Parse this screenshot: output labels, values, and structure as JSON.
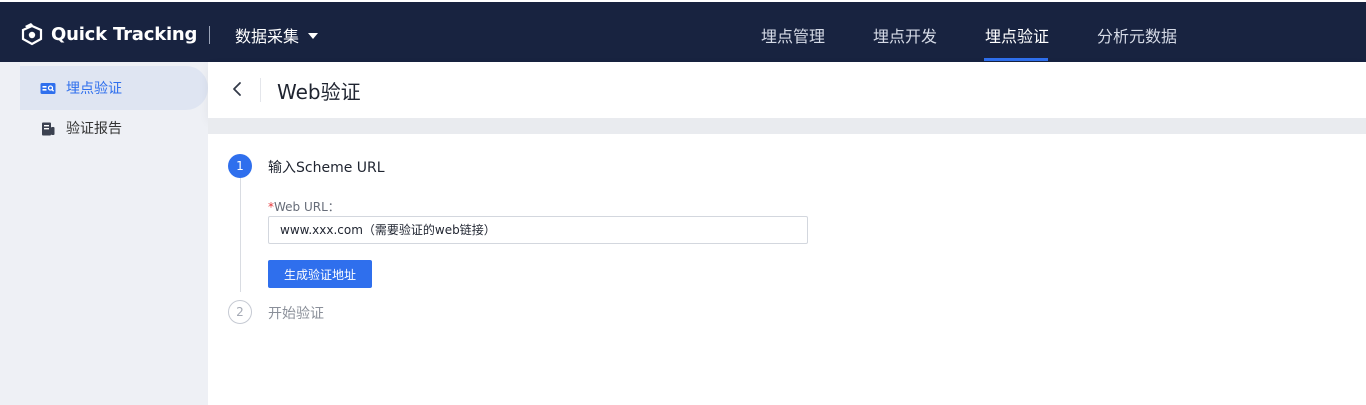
{
  "app": {
    "name": "Quick Tracking",
    "module": "数据采集"
  },
  "nav": {
    "items": [
      {
        "label": "埋点管理"
      },
      {
        "label": "埋点开发"
      },
      {
        "label": "埋点验证"
      },
      {
        "label": "分析元数据"
      }
    ],
    "active_index": 2
  },
  "sidebar": {
    "items": [
      {
        "label": "埋点验证",
        "icon": "id-card-icon"
      },
      {
        "label": "验证报告",
        "icon": "report-icon"
      }
    ],
    "active_index": 0
  },
  "page": {
    "title": "Web验证"
  },
  "steps": [
    {
      "number": "1",
      "title": "输入Scheme URL",
      "state": "active"
    },
    {
      "number": "2",
      "title": "开始验证",
      "state": "pending"
    }
  ],
  "form": {
    "required_mark": "*",
    "url_label": "Web URL：",
    "url_placeholder": "www.xxx.com（需要验证的web链接）",
    "submit_label": "生成验证地址"
  },
  "colors": {
    "topbar": "#182340",
    "accent": "#2f6fed",
    "sidebar": "#eef0f5"
  }
}
